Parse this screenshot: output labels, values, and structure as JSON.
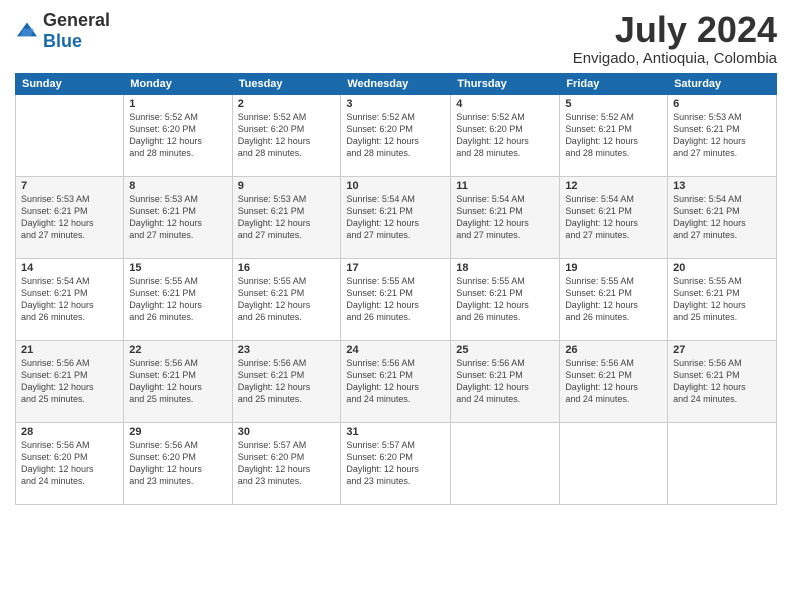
{
  "logo": {
    "general": "General",
    "blue": "Blue"
  },
  "title": "July 2024",
  "location": "Envigado, Antioquia, Colombia",
  "days_of_week": [
    "Sunday",
    "Monday",
    "Tuesday",
    "Wednesday",
    "Thursday",
    "Friday",
    "Saturday"
  ],
  "weeks": [
    [
      {
        "day": "",
        "info": ""
      },
      {
        "day": "1",
        "info": "Sunrise: 5:52 AM\nSunset: 6:20 PM\nDaylight: 12 hours\nand 28 minutes."
      },
      {
        "day": "2",
        "info": "Sunrise: 5:52 AM\nSunset: 6:20 PM\nDaylight: 12 hours\nand 28 minutes."
      },
      {
        "day": "3",
        "info": "Sunrise: 5:52 AM\nSunset: 6:20 PM\nDaylight: 12 hours\nand 28 minutes."
      },
      {
        "day": "4",
        "info": "Sunrise: 5:52 AM\nSunset: 6:20 PM\nDaylight: 12 hours\nand 28 minutes."
      },
      {
        "day": "5",
        "info": "Sunrise: 5:52 AM\nSunset: 6:21 PM\nDaylight: 12 hours\nand 28 minutes."
      },
      {
        "day": "6",
        "info": "Sunrise: 5:53 AM\nSunset: 6:21 PM\nDaylight: 12 hours\nand 27 minutes."
      }
    ],
    [
      {
        "day": "7",
        "info": "Sunrise: 5:53 AM\nSunset: 6:21 PM\nDaylight: 12 hours\nand 27 minutes."
      },
      {
        "day": "8",
        "info": "Sunrise: 5:53 AM\nSunset: 6:21 PM\nDaylight: 12 hours\nand 27 minutes."
      },
      {
        "day": "9",
        "info": "Sunrise: 5:53 AM\nSunset: 6:21 PM\nDaylight: 12 hours\nand 27 minutes."
      },
      {
        "day": "10",
        "info": "Sunrise: 5:54 AM\nSunset: 6:21 PM\nDaylight: 12 hours\nand 27 minutes."
      },
      {
        "day": "11",
        "info": "Sunrise: 5:54 AM\nSunset: 6:21 PM\nDaylight: 12 hours\nand 27 minutes."
      },
      {
        "day": "12",
        "info": "Sunrise: 5:54 AM\nSunset: 6:21 PM\nDaylight: 12 hours\nand 27 minutes."
      },
      {
        "day": "13",
        "info": "Sunrise: 5:54 AM\nSunset: 6:21 PM\nDaylight: 12 hours\nand 27 minutes."
      }
    ],
    [
      {
        "day": "14",
        "info": "Sunrise: 5:54 AM\nSunset: 6:21 PM\nDaylight: 12 hours\nand 26 minutes."
      },
      {
        "day": "15",
        "info": "Sunrise: 5:55 AM\nSunset: 6:21 PM\nDaylight: 12 hours\nand 26 minutes."
      },
      {
        "day": "16",
        "info": "Sunrise: 5:55 AM\nSunset: 6:21 PM\nDaylight: 12 hours\nand 26 minutes."
      },
      {
        "day": "17",
        "info": "Sunrise: 5:55 AM\nSunset: 6:21 PM\nDaylight: 12 hours\nand 26 minutes."
      },
      {
        "day": "18",
        "info": "Sunrise: 5:55 AM\nSunset: 6:21 PM\nDaylight: 12 hours\nand 26 minutes."
      },
      {
        "day": "19",
        "info": "Sunrise: 5:55 AM\nSunset: 6:21 PM\nDaylight: 12 hours\nand 26 minutes."
      },
      {
        "day": "20",
        "info": "Sunrise: 5:55 AM\nSunset: 6:21 PM\nDaylight: 12 hours\nand 25 minutes."
      }
    ],
    [
      {
        "day": "21",
        "info": "Sunrise: 5:56 AM\nSunset: 6:21 PM\nDaylight: 12 hours\nand 25 minutes."
      },
      {
        "day": "22",
        "info": "Sunrise: 5:56 AM\nSunset: 6:21 PM\nDaylight: 12 hours\nand 25 minutes."
      },
      {
        "day": "23",
        "info": "Sunrise: 5:56 AM\nSunset: 6:21 PM\nDaylight: 12 hours\nand 25 minutes."
      },
      {
        "day": "24",
        "info": "Sunrise: 5:56 AM\nSunset: 6:21 PM\nDaylight: 12 hours\nand 24 minutes."
      },
      {
        "day": "25",
        "info": "Sunrise: 5:56 AM\nSunset: 6:21 PM\nDaylight: 12 hours\nand 24 minutes."
      },
      {
        "day": "26",
        "info": "Sunrise: 5:56 AM\nSunset: 6:21 PM\nDaylight: 12 hours\nand 24 minutes."
      },
      {
        "day": "27",
        "info": "Sunrise: 5:56 AM\nSunset: 6:21 PM\nDaylight: 12 hours\nand 24 minutes."
      }
    ],
    [
      {
        "day": "28",
        "info": "Sunrise: 5:56 AM\nSunset: 6:20 PM\nDaylight: 12 hours\nand 24 minutes."
      },
      {
        "day": "29",
        "info": "Sunrise: 5:56 AM\nSunset: 6:20 PM\nDaylight: 12 hours\nand 23 minutes."
      },
      {
        "day": "30",
        "info": "Sunrise: 5:57 AM\nSunset: 6:20 PM\nDaylight: 12 hours\nand 23 minutes."
      },
      {
        "day": "31",
        "info": "Sunrise: 5:57 AM\nSunset: 6:20 PM\nDaylight: 12 hours\nand 23 minutes."
      },
      {
        "day": "",
        "info": ""
      },
      {
        "day": "",
        "info": ""
      },
      {
        "day": "",
        "info": ""
      }
    ]
  ]
}
